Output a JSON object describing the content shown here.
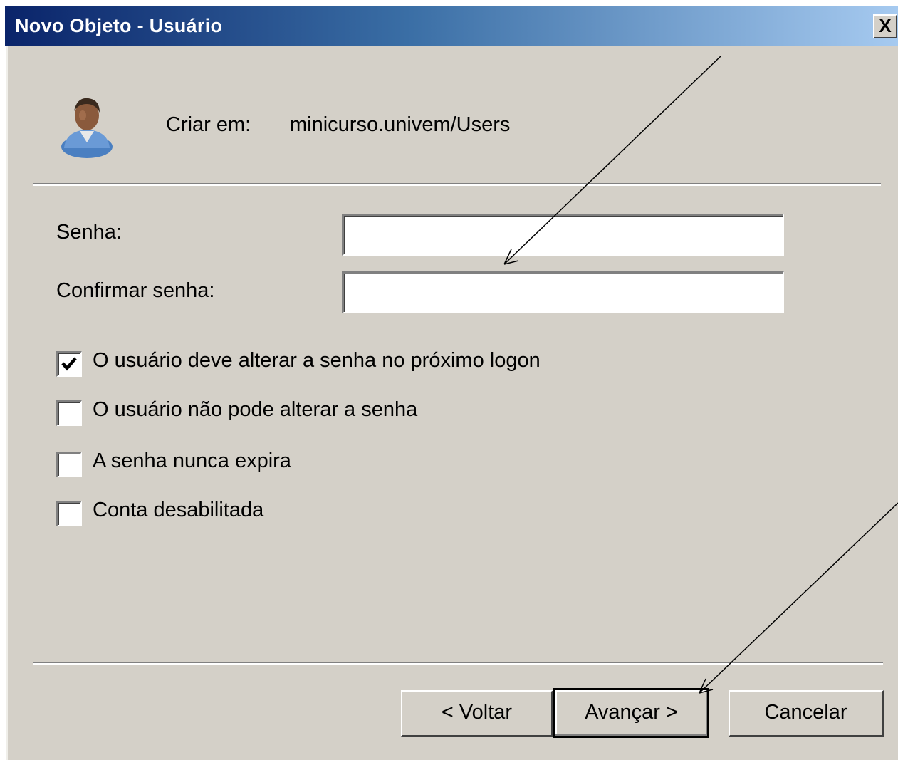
{
  "window": {
    "title": "Novo Objeto - Usuário",
    "close_label": "X"
  },
  "header": {
    "create_in_label": "Criar em:",
    "create_in_value": "minicurso.univem/Users",
    "icon": "user-icon"
  },
  "form": {
    "password_label": "Senha:",
    "password_value": "",
    "confirm_label": "Confirmar senha:",
    "confirm_value": ""
  },
  "options": [
    {
      "label": "O usuário deve alterar a senha no próximo logon",
      "checked": true
    },
    {
      "label": "O usuário não pode alterar a senha",
      "checked": false
    },
    {
      "label": "A senha nunca expira",
      "checked": false
    },
    {
      "label": "Conta desabilitada",
      "checked": false
    }
  ],
  "buttons": {
    "back": "< Voltar",
    "next": "Avançar >",
    "cancel": "Cancelar"
  },
  "colors": {
    "dialog_bg": "#d4d0c8",
    "title_start": "#0a246a",
    "title_end": "#a6caf0"
  }
}
